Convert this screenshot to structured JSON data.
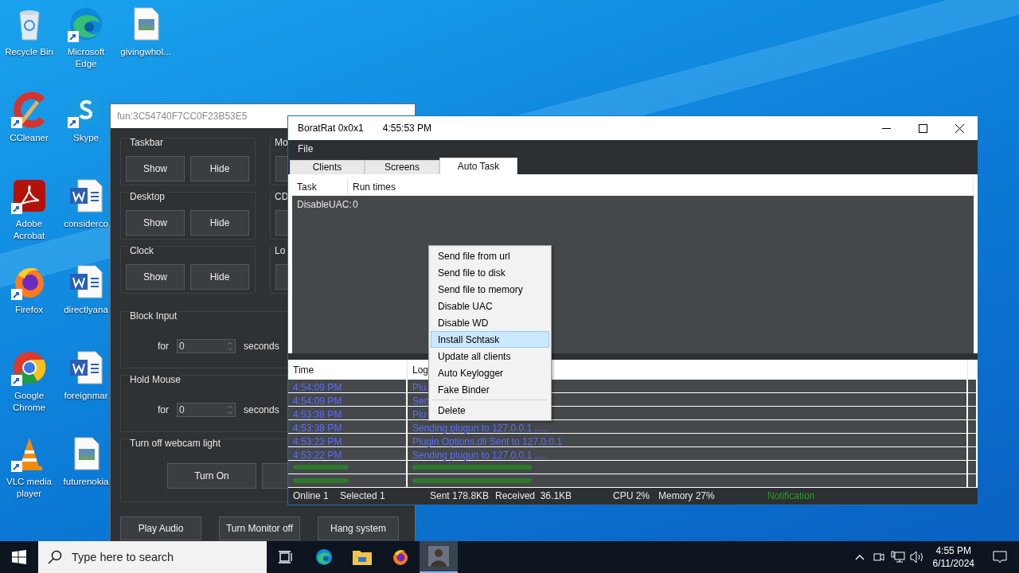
{
  "desktop_columns": [
    {
      "icons": [
        {
          "label": "Recycle Bin",
          "kind": "recycle",
          "shortcut": false
        },
        {
          "label": "CCleaner",
          "kind": "ccleaner",
          "shortcut": true
        },
        {
          "label": "Adobe Acrobat",
          "kind": "acrobat",
          "shortcut": true
        },
        {
          "label": "Firefox",
          "kind": "firefox",
          "shortcut": true
        },
        {
          "label": "Google Chrome",
          "kind": "chrome",
          "shortcut": true
        },
        {
          "label": "VLC media player",
          "kind": "vlc",
          "shortcut": true
        }
      ]
    },
    {
      "icons": [
        {
          "label": "Microsoft Edge",
          "kind": "edge",
          "shortcut": true
        },
        {
          "label": "Skype",
          "kind": "skype",
          "shortcut": true
        },
        {
          "label": "considerco",
          "kind": "word",
          "shortcut": false
        },
        {
          "label": "directlyana",
          "kind": "word",
          "shortcut": false
        },
        {
          "label": "foreignmar",
          "kind": "word",
          "shortcut": false
        },
        {
          "label": "futurenokia",
          "kind": "image",
          "shortcut": false
        }
      ]
    },
    {
      "icons": [
        {
          "label": "givingwhol...",
          "kind": "image",
          "shortcut": false
        }
      ]
    }
  ],
  "fun_window": {
    "title": "fun:3C54740F7CC0F23B53E5",
    "toggle_groups": [
      {
        "label": "Taskbar",
        "buttons": [
          "Show",
          "Hide"
        ],
        "side_label": "Mo"
      },
      {
        "label": "Desktop",
        "buttons": [
          "Show",
          "Hide"
        ],
        "side_label": "CD"
      },
      {
        "label": "Clock",
        "buttons": [
          "Show",
          "Hide"
        ],
        "side_label": "Lo"
      }
    ],
    "timed_groups": [
      {
        "label": "Block Input",
        "prefix": "for",
        "value": "0",
        "suffix": "seconds"
      },
      {
        "label": "Hold Mouse",
        "prefix": "for",
        "value": "0",
        "suffix": "seconds"
      }
    ],
    "webcam_group": {
      "label": "Turn off webcam light",
      "buttons": [
        "Turn On"
      ]
    },
    "bottom_buttons": [
      "Play Audio",
      "Turn Monitor off",
      "Hang system"
    ]
  },
  "main_window": {
    "title": "BoratRat 0x0x1",
    "clock": "4:55:53 PM",
    "menu": [
      "File"
    ],
    "tabs": [
      {
        "label": "Clients",
        "selected": false
      },
      {
        "label": "Screens",
        "selected": false
      },
      {
        "label": "Auto Task",
        "selected": true
      }
    ],
    "task_table": {
      "columns": [
        "Task",
        "Run times"
      ],
      "rows": [
        [
          "DisableUAC:",
          "0"
        ]
      ]
    },
    "log_table": {
      "columns": [
        "Time",
        "Log"
      ],
      "rows": [
        {
          "kind": "info",
          "time": "4:54:09 PM",
          "log": "Plu"
        },
        {
          "kind": "info",
          "time": "4:54:09 PM",
          "log": "Sen"
        },
        {
          "kind": "info",
          "time": "4:53:38 PM",
          "log": "Plu"
        },
        {
          "kind": "info",
          "time": "4:53:38 PM",
          "log": "Sending plugun to 127.0.0.1 ....."
        },
        {
          "kind": "info",
          "time": "4:53:23 PM",
          "log": "Plugin Options.dll Sent to 127.0.0.1"
        },
        {
          "kind": "info",
          "time": "4:53:22 PM",
          "log": "Sending plugun to 127.0.0.1 ....."
        },
        {
          "kind": "success"
        },
        {
          "kind": "success"
        }
      ]
    },
    "status_bar": [
      {
        "text": "Online 1",
        "kind": "plain"
      },
      {
        "text": "Selected 1",
        "kind": "plain"
      },
      {
        "text": "Sent 178.8KB",
        "kind": "plain"
      },
      {
        "text": "Received  36.1KB",
        "kind": "plain"
      },
      {
        "text": "CPU 2%",
        "kind": "plain"
      },
      {
        "text": "Memory 27%",
        "kind": "plain"
      },
      {
        "text": "Notification",
        "kind": "notice"
      }
    ],
    "context_menu": [
      {
        "label": "Send file from url",
        "selected": false
      },
      {
        "label": "Send file to disk",
        "selected": false
      },
      {
        "label": "Send file to memory",
        "selected": false
      },
      {
        "label": "Disable UAC",
        "selected": false
      },
      {
        "label": "Disable WD",
        "selected": false
      },
      {
        "label": "Install Schtask",
        "selected": true
      },
      {
        "label": "Update all clients",
        "selected": false
      },
      {
        "label": "Auto Keylogger",
        "selected": false
      },
      {
        "label": "Fake Binder",
        "selected": false
      },
      {
        "label": "Delete",
        "selected": false,
        "separated": true
      }
    ]
  },
  "taskbar": {
    "search": {
      "placeholder": "Type here to search"
    },
    "time": "4:55 PM",
    "date": "6/11/2024"
  }
}
